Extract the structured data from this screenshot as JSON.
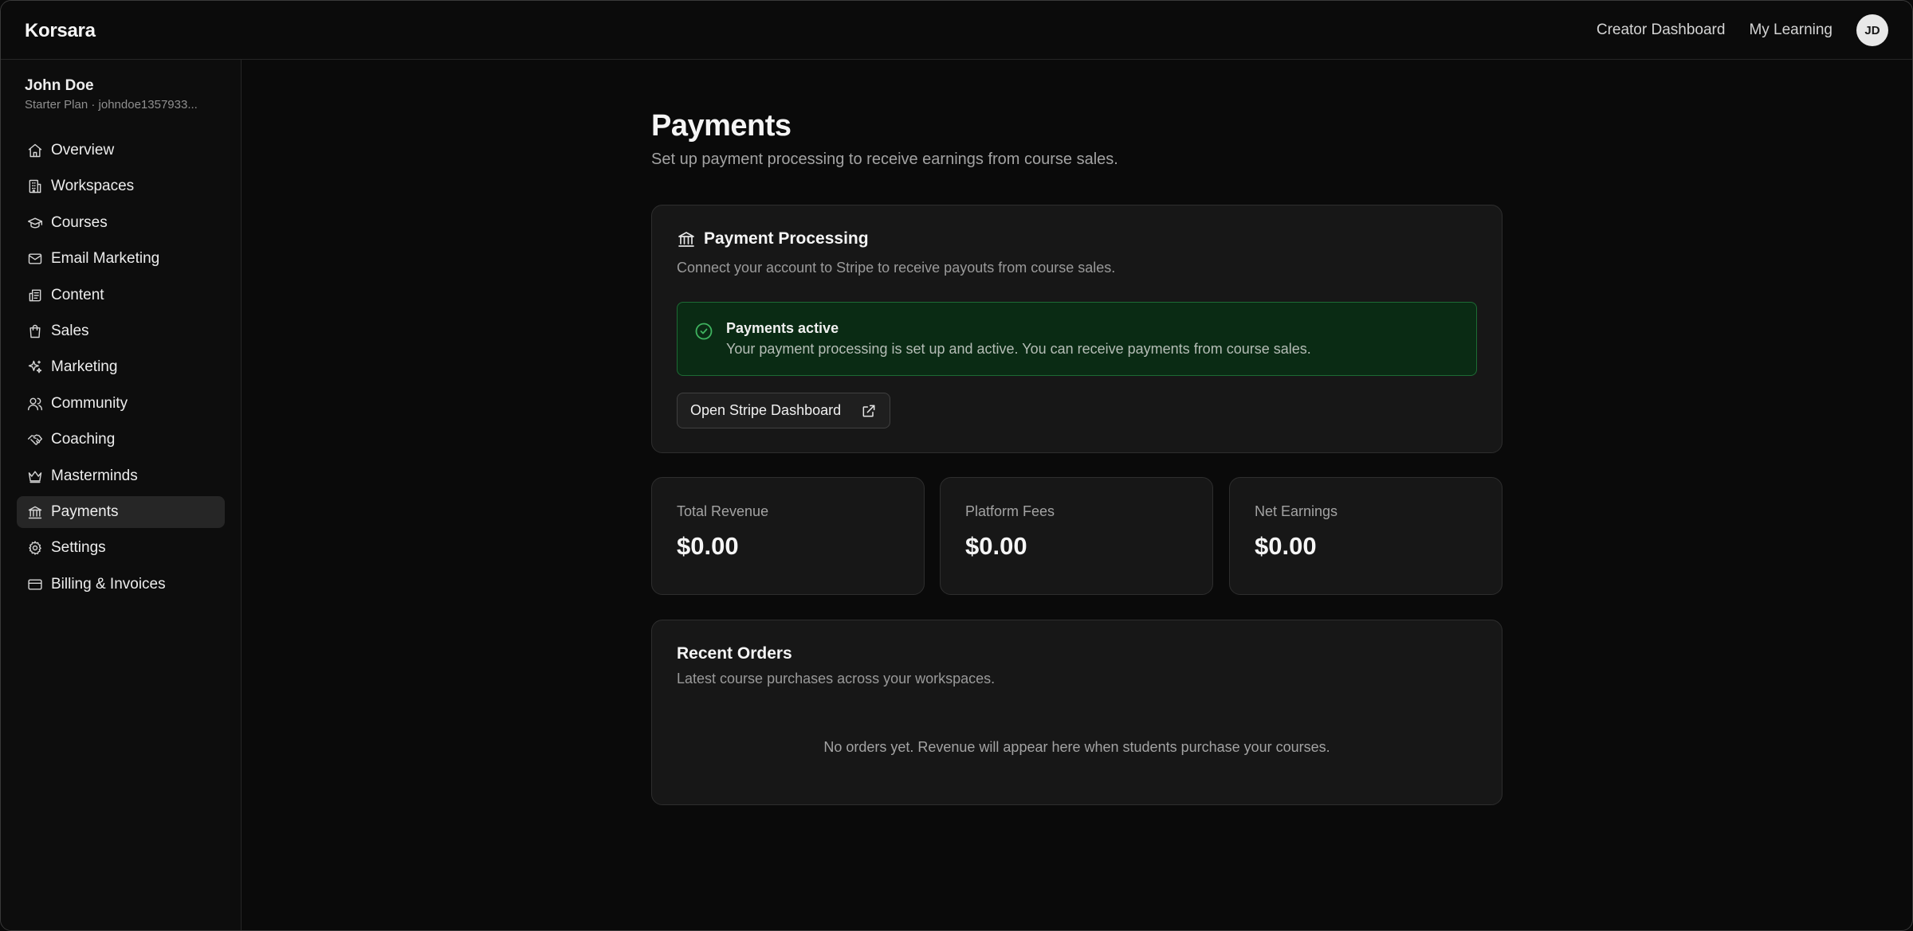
{
  "app": {
    "brand": "Korsara"
  },
  "header": {
    "links": [
      {
        "label": "Creator Dashboard"
      },
      {
        "label": "My Learning"
      }
    ],
    "avatar_initials": "JD"
  },
  "sidebar": {
    "user_name": "John Doe",
    "user_plan": "Starter Plan · johndoe1357933...",
    "items": [
      {
        "label": "Overview",
        "icon": "home-icon"
      },
      {
        "label": "Workspaces",
        "icon": "building-icon"
      },
      {
        "label": "Courses",
        "icon": "graduation-cap-icon"
      },
      {
        "label": "Email Marketing",
        "icon": "mail-icon"
      },
      {
        "label": "Content",
        "icon": "newspaper-icon"
      },
      {
        "label": "Sales",
        "icon": "shopping-bag-icon"
      },
      {
        "label": "Marketing",
        "icon": "sparkles-icon"
      },
      {
        "label": "Community",
        "icon": "users-icon"
      },
      {
        "label": "Coaching",
        "icon": "handshake-icon"
      },
      {
        "label": "Masterminds",
        "icon": "crown-icon"
      },
      {
        "label": "Payments",
        "icon": "landmark-icon",
        "active": true
      },
      {
        "label": "Settings",
        "icon": "gear-icon"
      },
      {
        "label": "Billing & Invoices",
        "icon": "credit-card-icon"
      }
    ]
  },
  "page": {
    "title": "Payments",
    "subtitle": "Set up payment processing to receive earnings from course sales."
  },
  "processing": {
    "title": "Payment Processing",
    "description": "Connect your account to Stripe to receive payouts from course sales.",
    "alert_title": "Payments active",
    "alert_text": "Your payment processing is set up and active. You can receive payments from course sales.",
    "button_label": "Open Stripe Dashboard"
  },
  "stats": [
    {
      "label": "Total Revenue",
      "value": "$0.00"
    },
    {
      "label": "Platform Fees",
      "value": "$0.00"
    },
    {
      "label": "Net Earnings",
      "value": "$0.00"
    }
  ],
  "orders": {
    "title": "Recent Orders",
    "description": "Latest course purchases across your workspaces.",
    "empty_text": "No orders yet. Revenue will appear here when students purchase your courses."
  },
  "colors": {
    "background": "#0a0a0a",
    "card": "#171717",
    "success_bg": "#0a2b14",
    "success_border": "#1d6b34",
    "success_icon": "#3fb35f"
  }
}
